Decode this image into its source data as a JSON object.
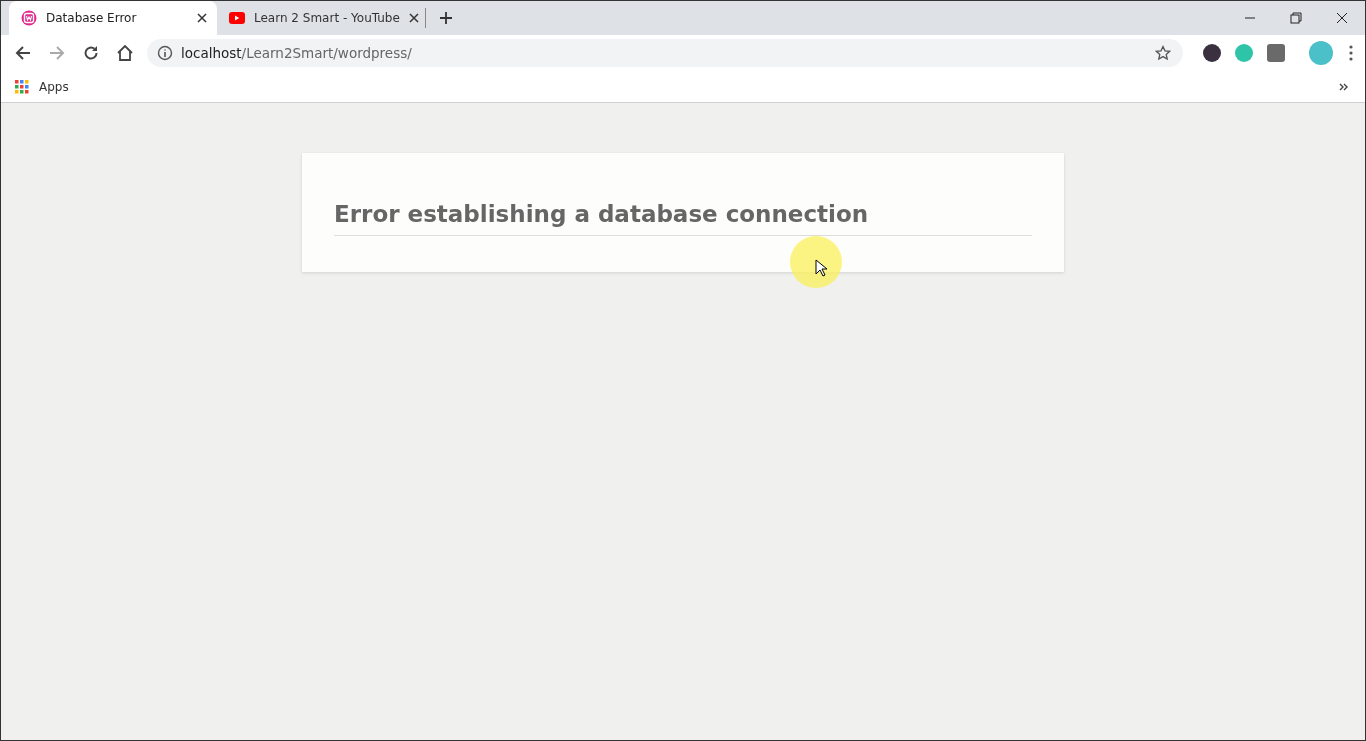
{
  "tabs": [
    {
      "title": "Database Error",
      "kind": "wamp",
      "selected": true
    },
    {
      "title": "Learn 2 Smart - YouTube",
      "kind": "youtube",
      "selected": false
    }
  ],
  "address_bar": {
    "host": "localhost",
    "path": "/Learn2Smart/wordpress/"
  },
  "bookmarks_bar": {
    "items": [
      "Apps"
    ]
  },
  "page": {
    "heading": "Error establishing a database connection"
  }
}
